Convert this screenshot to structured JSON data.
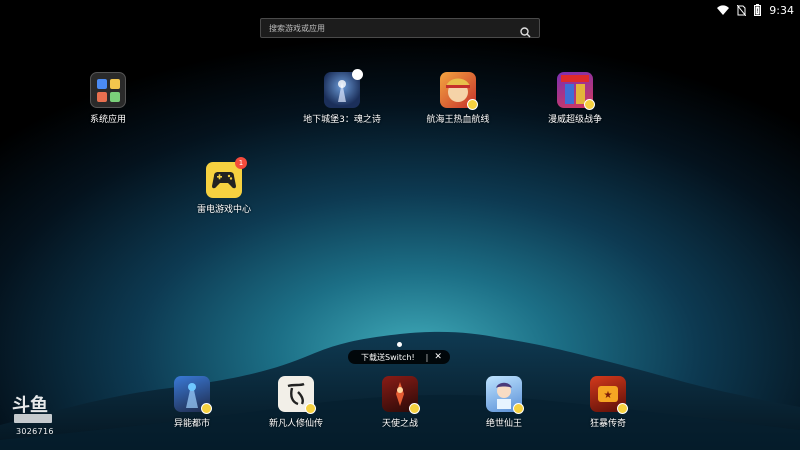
{
  "status_bar": {
    "time": "9:34",
    "icons": [
      "wifi-icon",
      "no-sim-icon",
      "battery-icon"
    ]
  },
  "search": {
    "placeholder": "搜索游戏或应用",
    "icon": "search-icon"
  },
  "desktop_apps": [
    {
      "label": "系统应用",
      "icon": "folder-icon"
    },
    {
      "label": "地下城堡3：魂之诗",
      "icon": "game-icon"
    },
    {
      "label": "航海王热血航线",
      "icon": "game-icon"
    },
    {
      "label": "漫威超级战争",
      "icon": "game-icon"
    },
    {
      "label": "雷电游戏中心",
      "icon": "gamepad-icon",
      "badge": "1"
    }
  ],
  "dock_apps": [
    {
      "label": "异能都市"
    },
    {
      "label": "新凡人修仙传"
    },
    {
      "label": "天使之战"
    },
    {
      "label": "绝世仙王"
    },
    {
      "label": "狂暴传奇"
    }
  ],
  "promo": {
    "text": "下载送Switch!",
    "separator": "|",
    "close": "✕"
  },
  "watermark": {
    "id": "3026716",
    "logo_text": "斗鱼"
  },
  "colors": {
    "accent_yellow": "#f6d140",
    "badge_red": "#f44b3c",
    "search_bg": "#1e1e1e"
  }
}
